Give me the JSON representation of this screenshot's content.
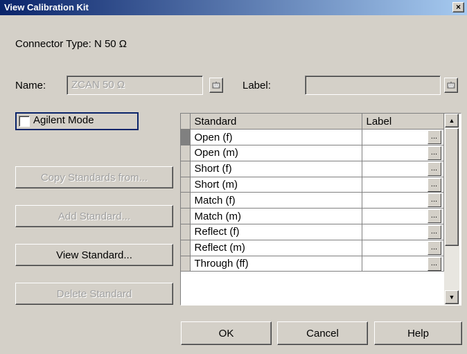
{
  "window": {
    "title": "View Calibration Kit",
    "close_glyph": "×"
  },
  "connector": {
    "label": "Connector Type: N 50 Ω"
  },
  "name_field": {
    "label": "Name:",
    "value": "ZCAN 50 Ω"
  },
  "label_field": {
    "label": "Label:",
    "value": ""
  },
  "agilent_mode": {
    "label": "Agilent Mode",
    "checked": false
  },
  "buttons": {
    "copy_standards": "Copy Standards from...",
    "add_standard": "Add Standard...",
    "view_standard": "View Standard...",
    "delete_standard": "Delete Standard",
    "ok": "OK",
    "cancel": "Cancel",
    "help": "Help"
  },
  "grid": {
    "columns": [
      "Standard",
      "Label"
    ],
    "ellipsis": "...",
    "rows": [
      {
        "standard": "Open (f)",
        "label": ""
      },
      {
        "standard": "Open (m)",
        "label": ""
      },
      {
        "standard": "Short (f)",
        "label": ""
      },
      {
        "standard": "Short (m)",
        "label": ""
      },
      {
        "standard": "Match (f)",
        "label": ""
      },
      {
        "standard": "Match (m)",
        "label": ""
      },
      {
        "standard": "Reflect (f)",
        "label": ""
      },
      {
        "standard": "Reflect (m)",
        "label": ""
      },
      {
        "standard": "Through (ff)",
        "label": ""
      }
    ]
  }
}
